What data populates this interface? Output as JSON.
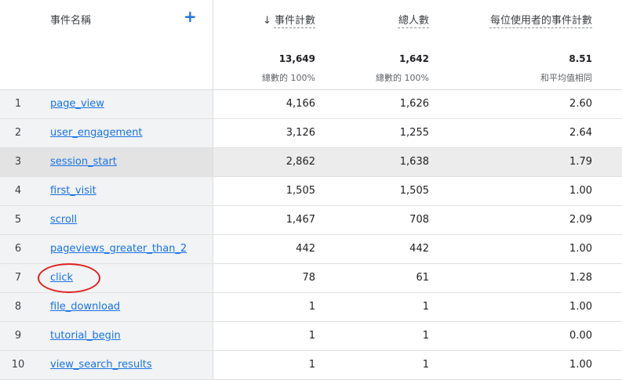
{
  "header": {
    "dimension_label": "事件名稱",
    "add_button": "+",
    "sort_arrow": "↓",
    "columns": [
      {
        "label": "事件計數",
        "total": "13,649",
        "sub": "總數的 100%"
      },
      {
        "label": "總人數",
        "total": "1,642",
        "sub": "總數的 100%"
      },
      {
        "label": "每位使用者的事件計數",
        "total": "8.51",
        "sub": "和平均值相同"
      }
    ]
  },
  "rows": [
    {
      "index": "1",
      "name": "page_view",
      "event_count": "4,166",
      "total_users": "1,626",
      "events_per_user": "2.60"
    },
    {
      "index": "2",
      "name": "user_engagement",
      "event_count": "3,126",
      "total_users": "1,255",
      "events_per_user": "2.64"
    },
    {
      "index": "3",
      "name": "session_start",
      "event_count": "2,862",
      "total_users": "1,638",
      "events_per_user": "1.79"
    },
    {
      "index": "4",
      "name": "first_visit",
      "event_count": "1,505",
      "total_users": "1,505",
      "events_per_user": "1.00"
    },
    {
      "index": "5",
      "name": "scroll",
      "event_count": "1,467",
      "total_users": "708",
      "events_per_user": "2.09"
    },
    {
      "index": "6",
      "name": "pageviews_greater_than_2",
      "event_count": "442",
      "total_users": "442",
      "events_per_user": "1.00"
    },
    {
      "index": "7",
      "name": "click",
      "event_count": "78",
      "total_users": "61",
      "events_per_user": "1.28"
    },
    {
      "index": "8",
      "name": "file_download",
      "event_count": "1",
      "total_users": "1",
      "events_per_user": "1.00"
    },
    {
      "index": "9",
      "name": "tutorial_begin",
      "event_count": "1",
      "total_users": "1",
      "events_per_user": "0.00"
    },
    {
      "index": "10",
      "name": "view_search_results",
      "event_count": "1",
      "total_users": "1",
      "events_per_user": "1.00"
    }
  ],
  "highlighted_row": 2,
  "annotation": {
    "circled_row": 6,
    "color": "#e02020"
  },
  "colors": {
    "link": "#1a73e8",
    "dim_bg": "#f1f3f4"
  }
}
